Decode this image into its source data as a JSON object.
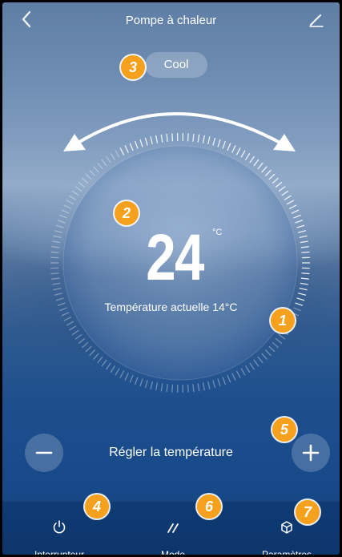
{
  "header": {
    "title": "Pompe à chaleur"
  },
  "mode": {
    "label": "Cool"
  },
  "thermostat": {
    "setpoint": "24",
    "unit": "°C",
    "current": "Température actuelle 14°C"
  },
  "controls": {
    "set_label": "Régler la température"
  },
  "bottom_nav": [
    {
      "label": "Interrupteur",
      "icon": "power-icon"
    },
    {
      "label": "Mode",
      "icon": "mode-icon"
    },
    {
      "label": "Paramètres",
      "icon": "settings-cube-icon"
    }
  ],
  "callouts": [
    "1",
    "2",
    "3",
    "4",
    "5",
    "6",
    "7"
  ],
  "colors": {
    "badge": "#f5a11e",
    "background_dark": "#123f7a",
    "background_light": "#93abc9"
  }
}
